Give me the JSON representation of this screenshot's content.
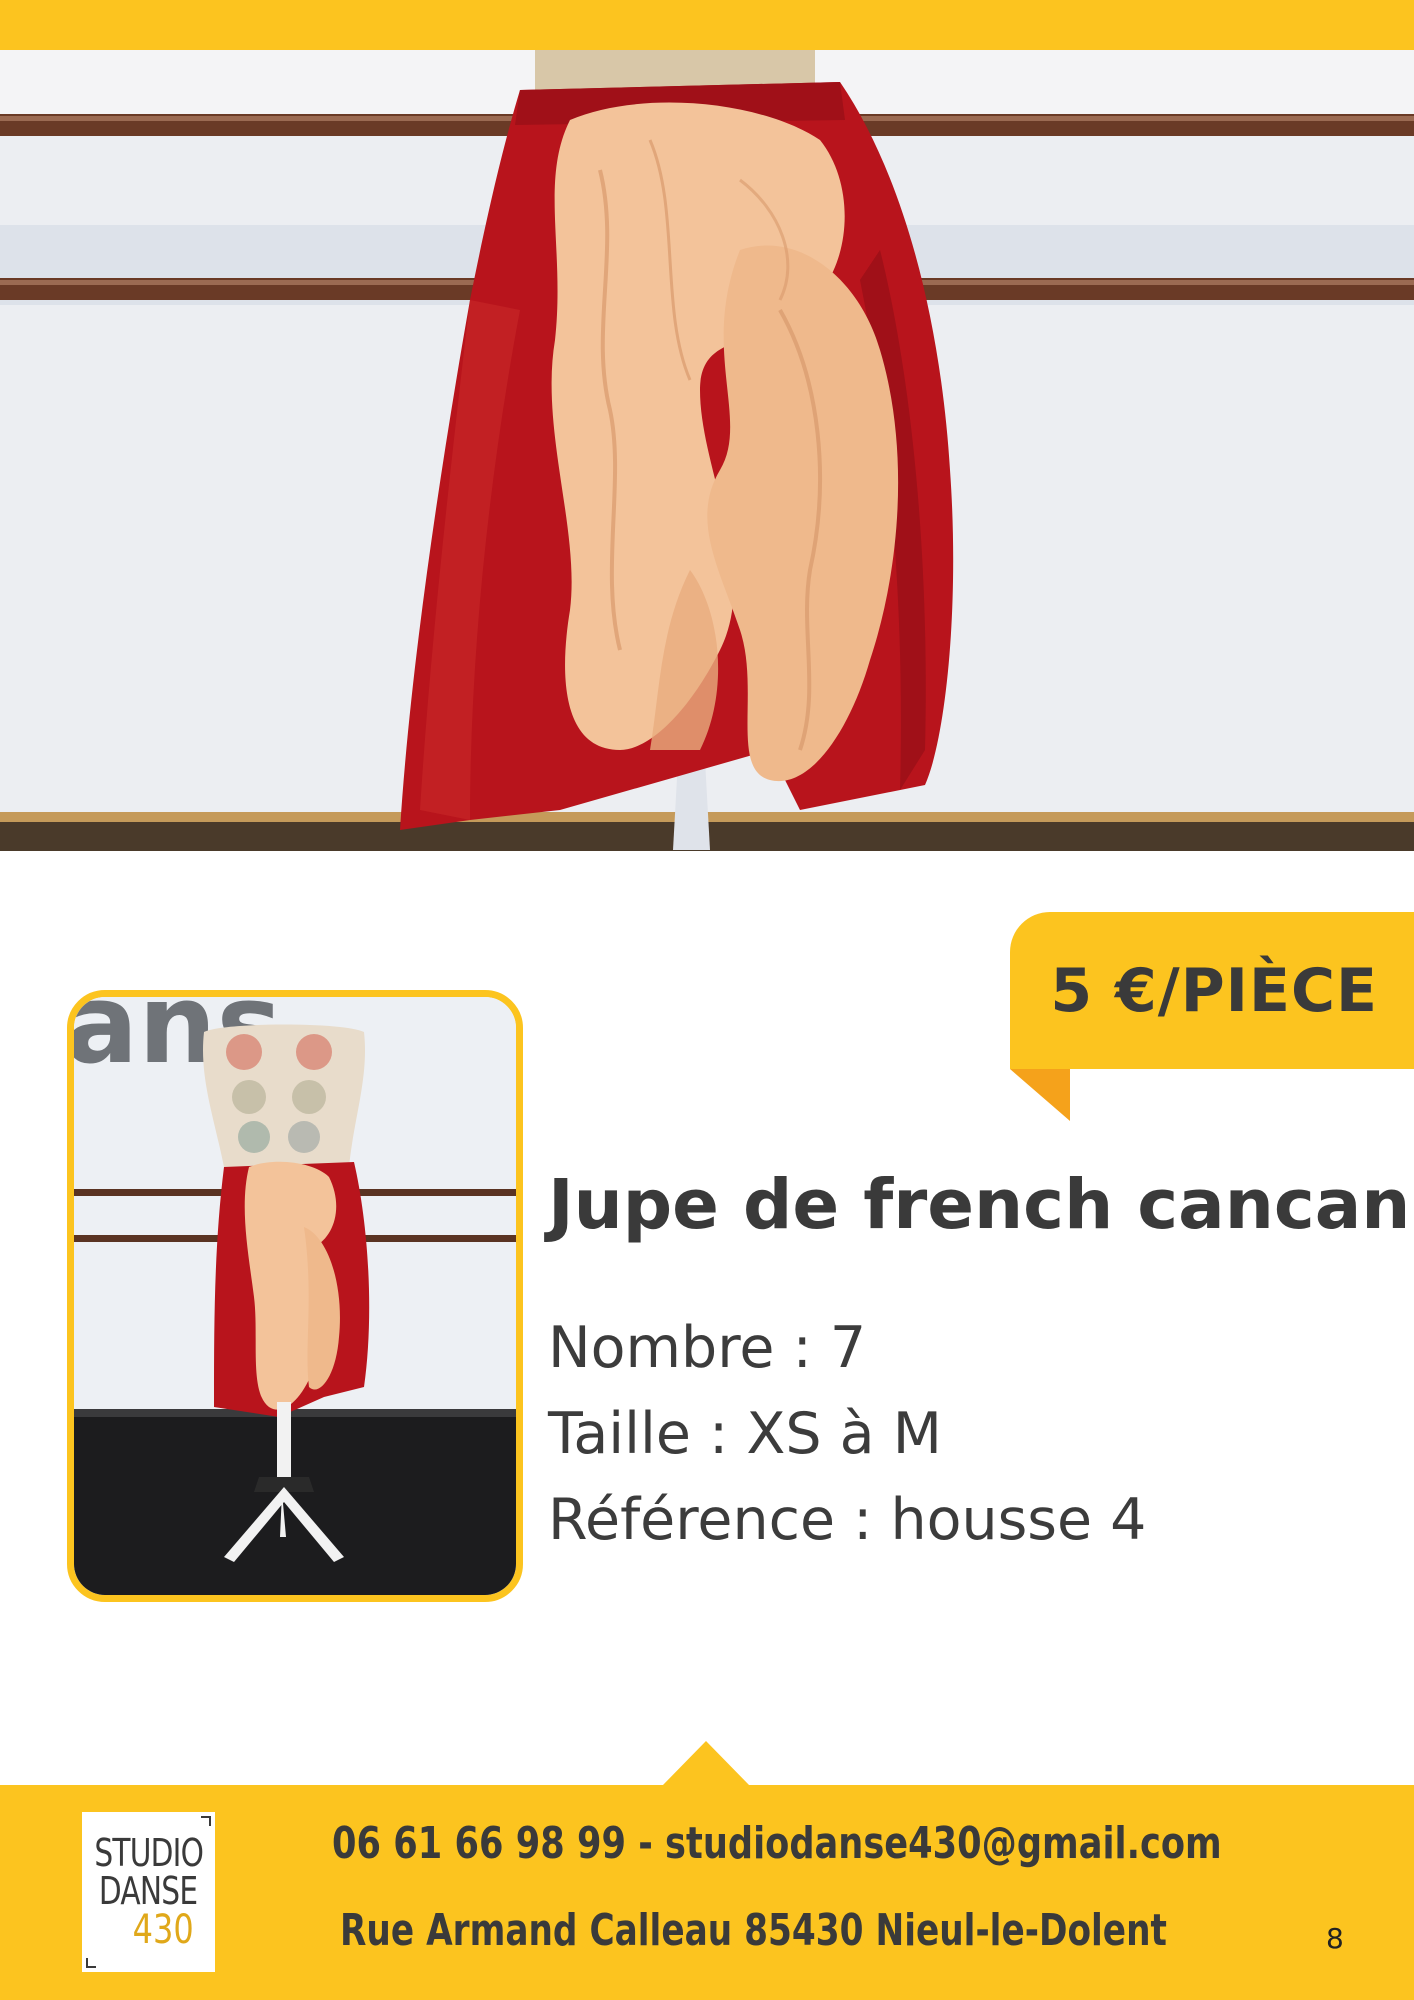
{
  "price_tag": {
    "label": "5 €/PIÈCE"
  },
  "product": {
    "title": "Jupe de french cancan",
    "count_line": "Nombre : 7",
    "size_line": "Taille : XS à M",
    "reference_line": "Référence : housse 4"
  },
  "footer": {
    "logo": {
      "line1": "STUDIO",
      "line2": "DANSE",
      "line3": "430"
    },
    "contact": "06 61 66 98 99 - studiodanse430@gmail.com",
    "address": "Rue Armand Calleau 85430 Nieul-le-Dolent",
    "page_number": "8"
  },
  "colors": {
    "accent_yellow": "#fcc41f",
    "accent_orange": "#f5a21b",
    "text_dark": "#3a3a3a",
    "skirt_red": "#b8141c",
    "ruffle_peach": "#f3c39a"
  }
}
